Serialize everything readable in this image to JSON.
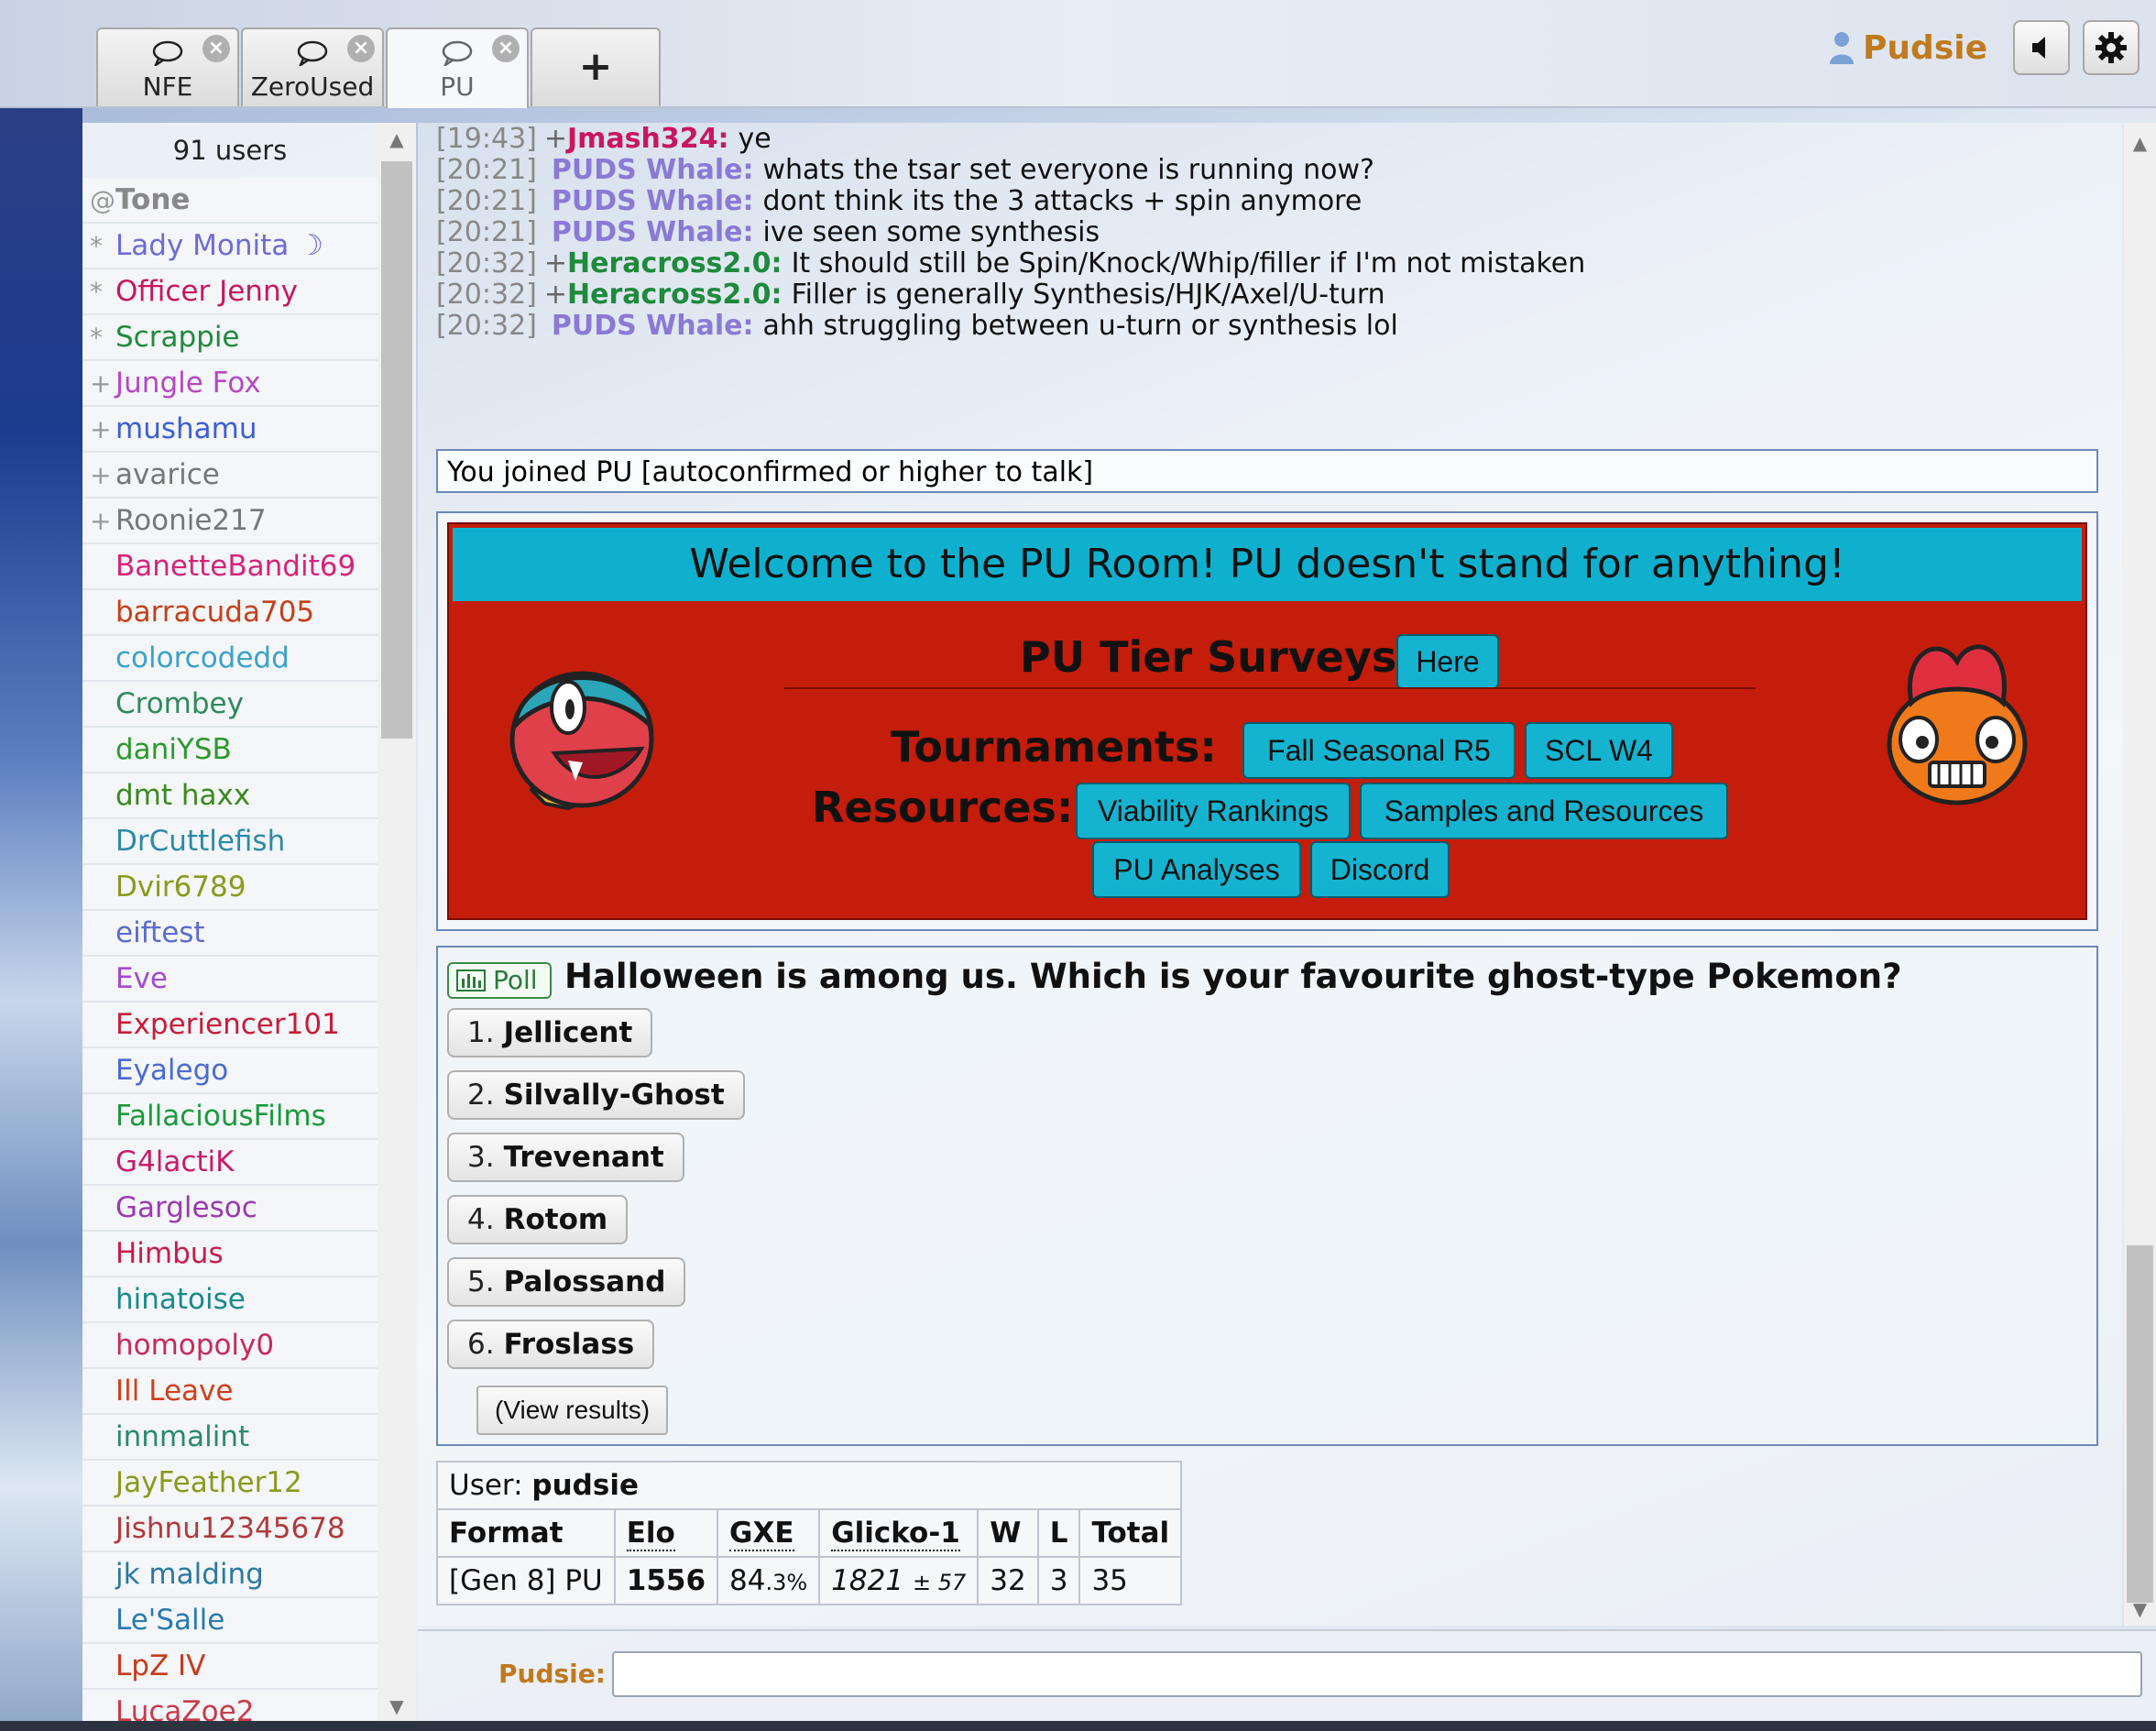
{
  "tabs": [
    {
      "label": "NFE",
      "active": false
    },
    {
      "label": "ZeroUsed",
      "active": false
    },
    {
      "label": "PU",
      "active": true
    }
  ],
  "add_tab_label": "+",
  "header": {
    "username": "Pudsie"
  },
  "colors": {
    "username": "#c07a1e",
    "welcome_red": "#c41d0c",
    "welcome_cyan": "#0fb0cd"
  },
  "userlist": {
    "count": "91 users",
    "users": [
      {
        "rank": "@",
        "name": "Tone",
        "color": "#888888",
        "bold": true
      },
      {
        "rank": "*",
        "name": "Lady Monita ☽",
        "color": "#6f6ad9"
      },
      {
        "rank": "*",
        "name": "Officer Jenny",
        "color": "#c8175f"
      },
      {
        "rank": "*",
        "name": "Scrappie",
        "color": "#1f8a3c"
      },
      {
        "rank": "+",
        "name": "Jungle Fox",
        "color": "#b548c4"
      },
      {
        "rank": "+",
        "name": "mushamu",
        "color": "#3c5fd6"
      },
      {
        "rank": "+",
        "name": "avarice",
        "color": "#777777"
      },
      {
        "rank": "+",
        "name": "Roonie217",
        "color": "#777777"
      },
      {
        "rank": "",
        "name": "BanetteBandit69",
        "color": "#d6247a"
      },
      {
        "rank": "",
        "name": "barracuda705",
        "color": "#c4401c"
      },
      {
        "rank": "",
        "name": "colorcodedd",
        "color": "#3aa3c9"
      },
      {
        "rank": "",
        "name": "Crombey",
        "color": "#2e8a5c"
      },
      {
        "rank": "",
        "name": "daniYSB",
        "color": "#2b9a2b"
      },
      {
        "rank": "",
        "name": "dmt haxx",
        "color": "#3a8a1c"
      },
      {
        "rank": "",
        "name": "DrCuttlefish",
        "color": "#2a8aa8"
      },
      {
        "rank": "",
        "name": "Dvir6789",
        "color": "#8a9a1c"
      },
      {
        "rank": "",
        "name": "eiftest",
        "color": "#5a6ad0"
      },
      {
        "rank": "",
        "name": "Eve",
        "color": "#a44ad0"
      },
      {
        "rank": "",
        "name": "Experiencer101",
        "color": "#c81c3a"
      },
      {
        "rank": "",
        "name": "Eyalego",
        "color": "#4a6ad6"
      },
      {
        "rank": "",
        "name": "FallaciousFilms",
        "color": "#1a9a3a"
      },
      {
        "rank": "",
        "name": "G4lactiK",
        "color": "#c81c6a"
      },
      {
        "rank": "",
        "name": "Garglesoc",
        "color": "#9a3ab0"
      },
      {
        "rank": "",
        "name": "Himbus",
        "color": "#c81c4a"
      },
      {
        "rank": "",
        "name": "hinatoise",
        "color": "#1a8a8a"
      },
      {
        "rank": "",
        "name": "homopoly0",
        "color": "#c82a5a"
      },
      {
        "rank": "",
        "name": "Ill Leave",
        "color": "#d0401a"
      },
      {
        "rank": "",
        "name": "innmalint",
        "color": "#2a8a6a"
      },
      {
        "rank": "",
        "name": "JayFeather12",
        "color": "#8a9a1a"
      },
      {
        "rank": "",
        "name": "Jishnu12345678",
        "color": "#b03a3a"
      },
      {
        "rank": "",
        "name": "jk malding",
        "color": "#2a7aa0"
      },
      {
        "rank": "",
        "name": "Le'Salle",
        "color": "#2a7ab0"
      },
      {
        "rank": "",
        "name": "LpZ IV",
        "color": "#c83a1a"
      },
      {
        "rank": "",
        "name": "LucaZoe2",
        "color": "#c83a4a"
      }
    ]
  },
  "chat": {
    "messages": [
      {
        "time": "[19:43]",
        "rank": "+",
        "nick": "Jmash324:",
        "color": "#c8175f",
        "text": "ye"
      },
      {
        "time": "[20:21]",
        "rank": "",
        "nick": "PUDS Whale:",
        "color": "#8a7ad6",
        "text": "whats the tsar set everyone is running now?"
      },
      {
        "time": "[20:21]",
        "rank": "",
        "nick": "PUDS Whale:",
        "color": "#8a7ad6",
        "text": "dont think its the 3 attacks + spin anymore"
      },
      {
        "time": "[20:21]",
        "rank": "",
        "nick": "PUDS Whale:",
        "color": "#8a7ad6",
        "text": "ive seen some synthesis"
      },
      {
        "time": "[20:32]",
        "rank": "+",
        "nick": "Heracross2.0:",
        "color": "#1f8a3c",
        "text": "It should still be Spin/Knock/Whip/filler if I'm not mistaken"
      },
      {
        "time": "[20:32]",
        "rank": "+",
        "nick": "Heracross2.0:",
        "color": "#1f8a3c",
        "text": "Filler is generally Synthesis/HJK/Axel/U-turn"
      },
      {
        "time": "[20:32]",
        "rank": "",
        "nick": "PUDS Whale:",
        "color": "#8a7ad6",
        "text": "ahh struggling between u-turn or synthesis lol"
      }
    ],
    "join_notice": "You joined PU [autoconfirmed or higher to talk]"
  },
  "welcome": {
    "banner": "Welcome to the PU Room! PU doesn't stand for anything!",
    "surveys_label": "PU Tier Surveys!",
    "surveys_button": "Here",
    "tournaments_label": "Tournaments:",
    "tournament_buttons": [
      "Fall Seasonal R5",
      "SCL W4"
    ],
    "resources_label": "Resources:",
    "resource_buttons": [
      "Viability Rankings",
      "Samples and Resources",
      "PU Analyses",
      "Discord"
    ]
  },
  "poll": {
    "tag": "Poll",
    "question": "Halloween is among us. Which is your favourite ghost-type Pokemon?",
    "options": [
      {
        "num": "1.",
        "name": "Jellicent"
      },
      {
        "num": "2.",
        "name": "Silvally-Ghost"
      },
      {
        "num": "3.",
        "name": "Trevenant"
      },
      {
        "num": "4.",
        "name": "Rotom"
      },
      {
        "num": "5.",
        "name": "Palossand"
      },
      {
        "num": "6.",
        "name": "Froslass"
      }
    ],
    "view_results": "(View results)"
  },
  "rank_table": {
    "user_label": "User:",
    "user": "pudsie",
    "headers": [
      "Format",
      "Elo",
      "GXE",
      "Glicko-1",
      "W",
      "L",
      "Total"
    ],
    "row": {
      "format": "[Gen 8] PU",
      "elo": "1556",
      "gxe_main": "84",
      "gxe_dec": ".3%",
      "glicko": "1821",
      "glicko_dev": "± 57",
      "w": "32",
      "l": "3",
      "total": "35"
    }
  },
  "input": {
    "label": "Pudsie:",
    "value": ""
  }
}
